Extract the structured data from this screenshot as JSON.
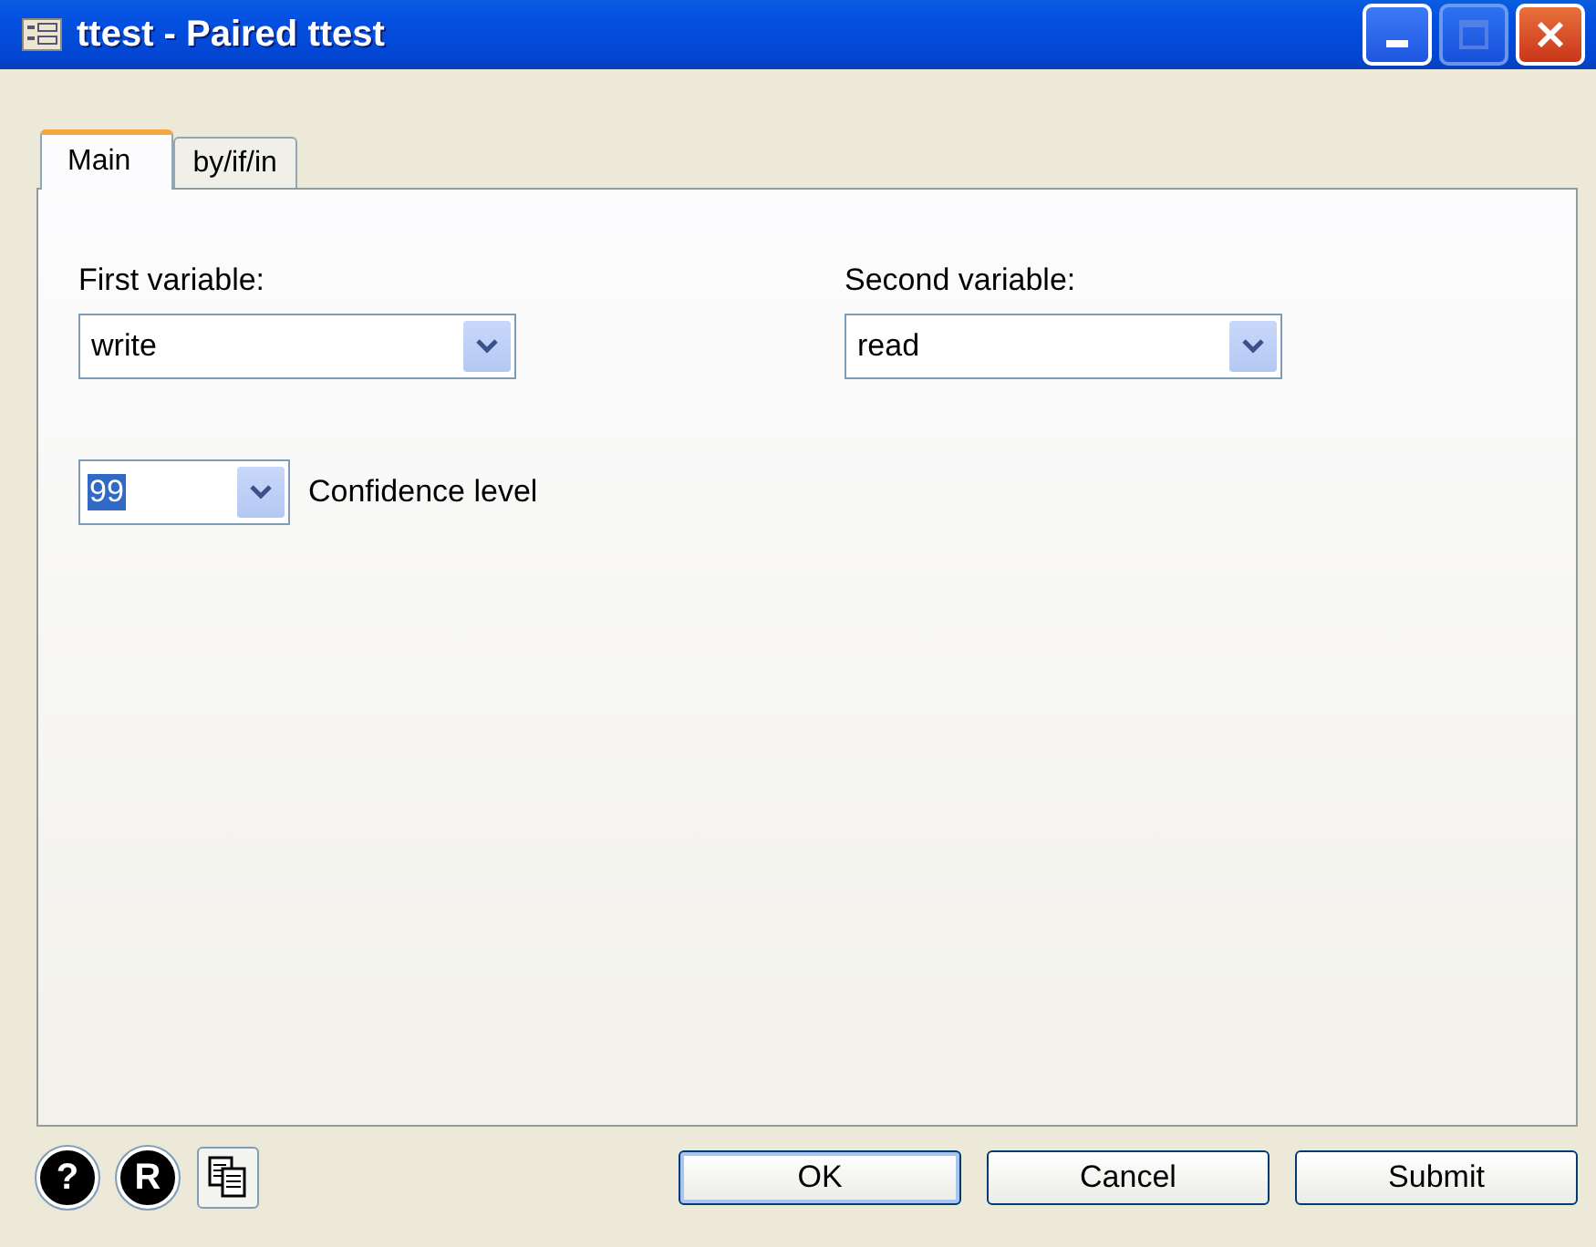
{
  "window": {
    "title": "ttest - Paired ttest"
  },
  "tabs": [
    {
      "label": "Main",
      "selected": true
    },
    {
      "label": "by/if/in",
      "selected": false
    }
  ],
  "fields": [
    {
      "label": "First variable:",
      "value": "write"
    },
    {
      "label": "Second variable:",
      "value": "read"
    }
  ],
  "confidence": {
    "value": "99",
    "value_selected": true,
    "label": "Confidence level"
  },
  "tool_buttons": [
    {
      "kind": "help",
      "glyph": "?"
    },
    {
      "kind": "r",
      "glyph": "R"
    },
    {
      "kind": "copy"
    }
  ],
  "buttons": [
    {
      "label": "OK",
      "default": true
    },
    {
      "label": "Cancel",
      "default": false
    },
    {
      "label": "Submit",
      "default": false
    }
  ]
}
